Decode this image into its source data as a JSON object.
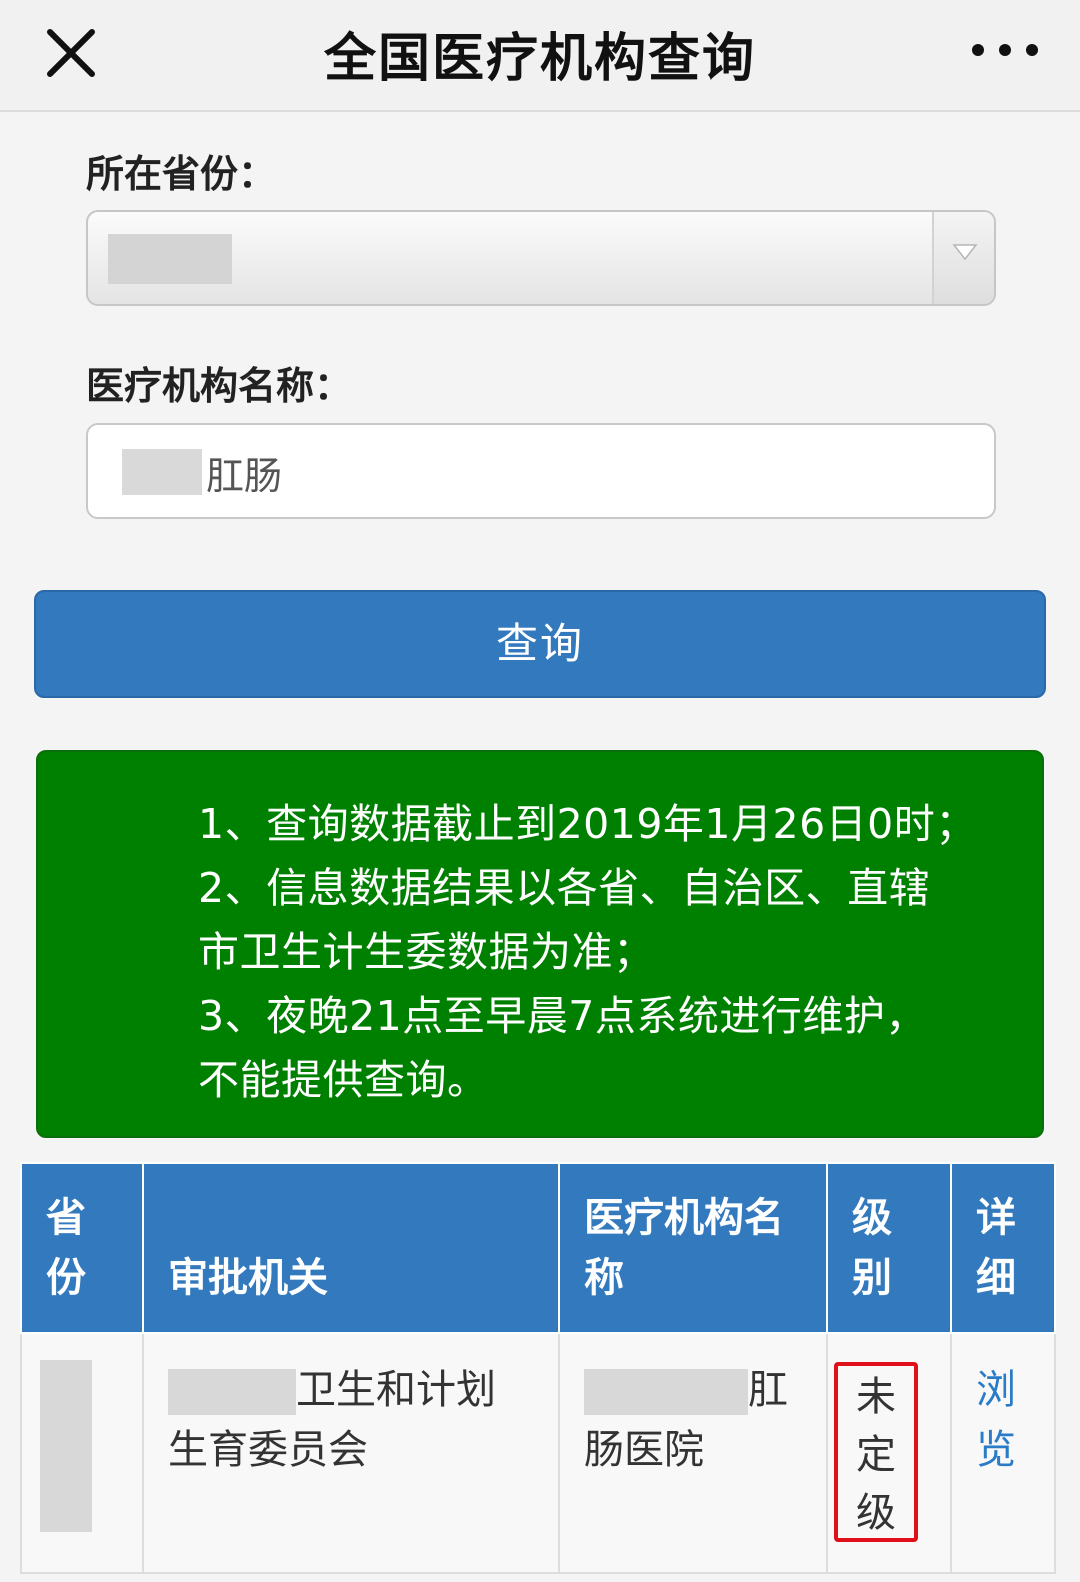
{
  "nav": {
    "title": "全国医疗机构查询",
    "close_icon": "close-icon",
    "more_icon": "more-dots-icon"
  },
  "form": {
    "province_label": "所在省份：",
    "province_value": "",
    "institution_label": "医疗机构名称：",
    "institution_value": "肛肠",
    "query_button": "查询"
  },
  "notice": {
    "lines": [
      "1、查询数据截止到2019年1月26日0时；",
      "2、信息数据结果以各省、自治区、直辖",
      "市卫生计生委数据为准；",
      "3、夜晚21点至早晨7点系统进行维护，",
      "不能提供查询。"
    ],
    "background": "#008000"
  },
  "table": {
    "headers": [
      [
        "省",
        "份"
      ],
      [
        "审批机关"
      ],
      [
        "医疗机构名",
        "称"
      ],
      [
        "级",
        "别"
      ],
      [
        "详",
        "细"
      ]
    ],
    "rows": [
      {
        "province": "",
        "authority": [
          "卫生和计划",
          "生育委员会"
        ],
        "institution": [
          "肛",
          "肠医院"
        ],
        "level": [
          "未",
          "定",
          "级"
        ],
        "detail": [
          "浏",
          "览"
        ]
      }
    ],
    "header_color": "#3379bd",
    "highlight_color": "#e0101a",
    "link_color": "#2a7bc8"
  }
}
